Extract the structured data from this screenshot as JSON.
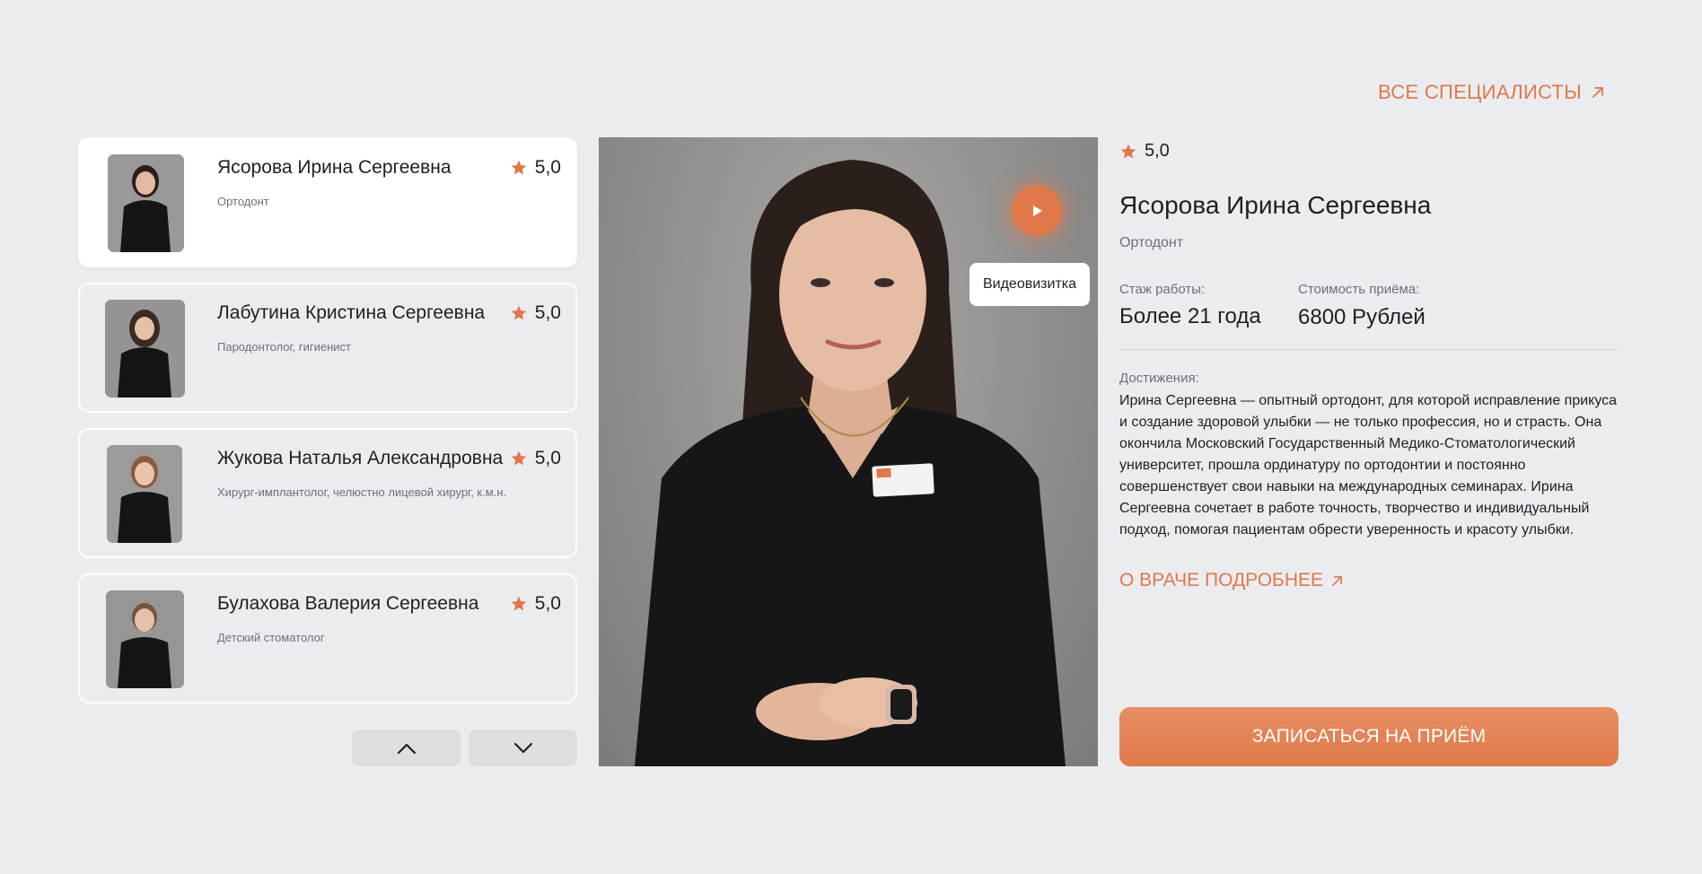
{
  "header": {
    "all_specialists_label": "ВСЕ СПЕЦИАЛИСТЫ"
  },
  "doctors": [
    {
      "name": "Ясорова Ирина Сергеевна",
      "specialty": "Ортодонт",
      "rating": "5,0"
    },
    {
      "name": "Лабутина Кристина Сергеевна",
      "specialty": "Пародонтолог, гигиенист",
      "rating": "5,0"
    },
    {
      "name": "Жукова Наталья Александровна",
      "specialty": "Хирург-имплантолог, челюстно лицевой хирург, к.м.н.",
      "rating": "5,0"
    },
    {
      "name": "Булахова Валерия Сергеевна",
      "specialty": "Детский стоматолог",
      "rating": "5,0"
    }
  ],
  "photo": {
    "video_label": "Видеовизитка"
  },
  "detail": {
    "rating": "5,0",
    "name": "Ясорова Ирина Сергеевна",
    "specialty": "Ортодонт",
    "experience_label": "Стаж работы:",
    "experience_value": "Более 21 года",
    "price_label": "Стоимость приёма:",
    "price_value": "6800 Рублей",
    "achievements_label": "Достижения:",
    "achievements_text": "Ирина Сергеевна — опытный ортодонт, для которой исправление прикуса и создание здоровой улыбки — не только профессия, но и страсть. Она окончила Московский Государственный Медико-Стоматологический университет, прошла ординатуру по ортодонтии и постоянно совершенствует свои навыки на международных семинарах. Ирина Сергеевна сочетает в работе точность, творчество и индивидуальный подход, помогая пациентам обрести уверенность и красоту улыбки.",
    "more_label": "О ВРАЧЕ ПОДРОБНЕЕ",
    "book_label": "ЗАПИСАТЬСЯ НА ПРИЁМ"
  },
  "colors": {
    "accent": "#e0784a",
    "background": "#eaecf0",
    "card_active": "#ffffff"
  },
  "icons": [
    "arrow-up-right-icon",
    "star-icon",
    "chevron-up-icon",
    "chevron-down-icon",
    "play-icon"
  ]
}
